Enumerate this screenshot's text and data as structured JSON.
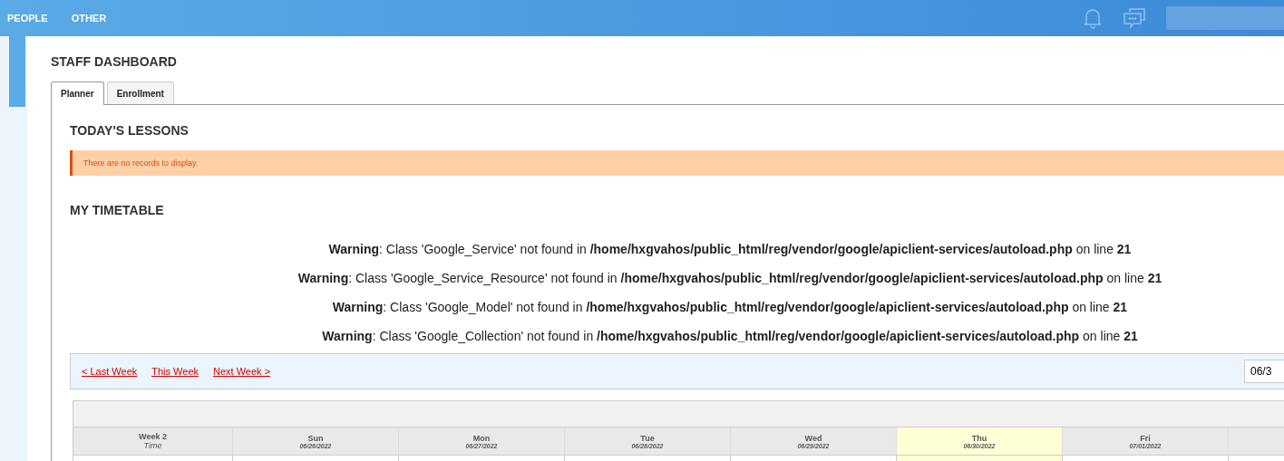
{
  "nav": {
    "items": [
      {
        "label": "PEOPLE"
      },
      {
        "label": "OTHER"
      }
    ]
  },
  "page_title": "STAFF DASHBOARD",
  "tabs": [
    {
      "label": "Planner",
      "selected": true
    },
    {
      "label": "Enrollment",
      "selected": false
    }
  ],
  "todays_lessons": {
    "heading": "TODAY'S LESSONS",
    "notice": "There are no records to display."
  },
  "timetable": {
    "heading": "MY TIMETABLE",
    "warnings": [
      "**Warning**: Class 'Google_Service' not found in **/home/hxgvahos/public_html/reg/vendor/google/apiclient-services/autoload.php** on line **21**",
      "**Warning**: Class 'Google_Service_Resource' not found in **/home/hxgvahos/public_html/reg/vendor/google/apiclient-services/autoload.php** on line **21**",
      "**Warning**: Class 'Google_Model' not found in **/home/hxgvahos/public_html/reg/vendor/google/apiclient-services/autoload.php** on line **21**",
      "**Warning**: Class 'Google_Collection' not found in **/home/hxgvahos/public_html/reg/vendor/google/apiclient-services/autoload.php** on line **21**"
    ],
    "week_links": [
      {
        "label": "< Last Week"
      },
      {
        "label": "This Week"
      },
      {
        "label": "Next Week >"
      }
    ],
    "date_value": "06/3",
    "week_label": "Week 2",
    "time_label": "Time",
    "days": [
      {
        "name": "Sun",
        "date": "06/26/2022",
        "selected": false
      },
      {
        "name": "Mon",
        "date": "06/27/2022",
        "selected": false
      },
      {
        "name": "Tue",
        "date": "06/28/2022",
        "selected": false
      },
      {
        "name": "Wed",
        "date": "06/29/2022",
        "selected": false
      },
      {
        "name": "Thu",
        "date": "06/30/2022",
        "selected": true
      },
      {
        "name": "Fri",
        "date": "07/01/2022",
        "selected": false
      }
    ]
  }
}
